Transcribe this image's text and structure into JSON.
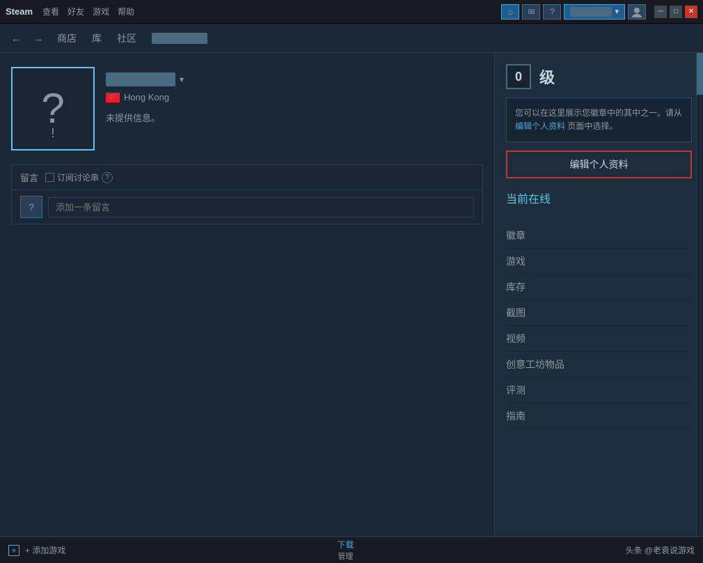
{
  "titlebar": {
    "brand": "Steam",
    "menu": [
      "查看",
      "好友",
      "游戏",
      "帮助"
    ],
    "user_label": "1████2 ▾",
    "notif_icons": [
      "✉",
      "?"
    ],
    "window_controls": [
      "─",
      "□",
      "✕"
    ]
  },
  "navbar": {
    "back": "←",
    "forward": "→",
    "links": [
      "商店",
      "库",
      "社区"
    ],
    "username_blurred": "1████2"
  },
  "profile": {
    "username": "1████2",
    "dropdown_arrow": "▾",
    "location": "Hong Kong",
    "bio": "未提供信息。",
    "bio_empty": true
  },
  "level_section": {
    "level_number": "0",
    "level_label": "级"
  },
  "badge_info": {
    "text": "您可以在这里展示您徽章中的其中之一。请从",
    "link_text": "编辑个人资料",
    "text2": "页面中选择。"
  },
  "edit_profile_btn": "编辑个人资料",
  "online_status": "当前在线",
  "sidebar_nav": [
    {
      "label": "徽章"
    },
    {
      "label": "游戏"
    },
    {
      "label": "库存"
    },
    {
      "label": "截图"
    },
    {
      "label": "视频"
    },
    {
      "label": "创意工坊物品"
    },
    {
      "label": "评测"
    },
    {
      "label": "指南"
    }
  ],
  "comments": {
    "header": "留言",
    "subscribe_label": "订阅讨论串",
    "help_icon": "?",
    "placeholder": "添加一条留言"
  },
  "statusbar": {
    "add_game": "+ 添加游戏",
    "download_label": "下载",
    "download_sub": "管理"
  },
  "watermark": "头条 @老袁说游戏",
  "colors": {
    "accent": "#4fa3d5",
    "online": "#57cbde",
    "edit_btn_border": "#c0392b",
    "level_bg": "#162330"
  }
}
